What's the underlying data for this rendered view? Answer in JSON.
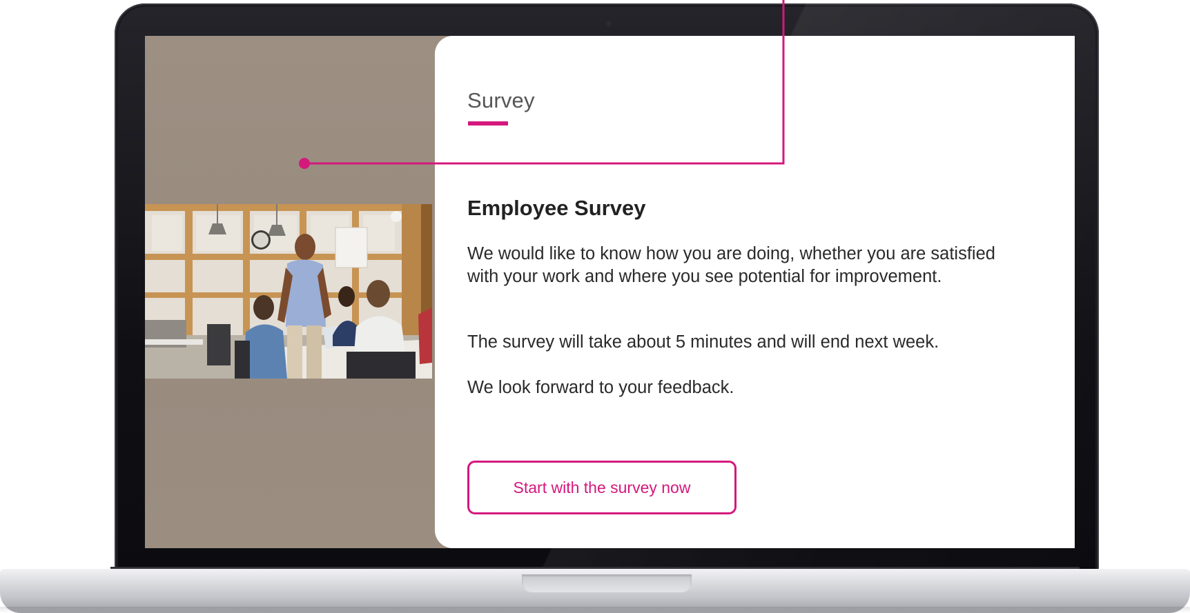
{
  "survey": {
    "eyebrow": "Survey",
    "title": "Employee Survey",
    "intro": "We would like to know how you are doing, whether you are satisfied with your work and where you see potential for improvement.",
    "duration": "The survey will take about 5 minutes and will end next week.",
    "closing": "We look forward to your feedback.",
    "cta_label": "Start with the survey now"
  },
  "colors": {
    "accent": "#d4187c",
    "left_panel": "#9c8f82",
    "card": "#ffffff"
  },
  "icons": {
    "photo": "team-meeting-photo"
  }
}
